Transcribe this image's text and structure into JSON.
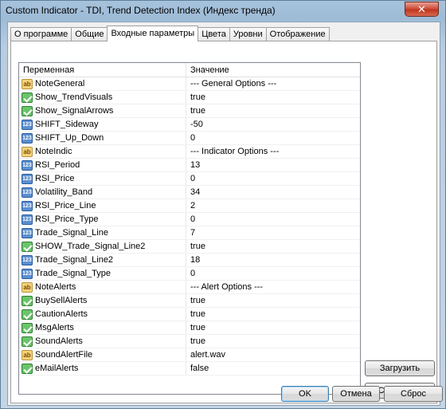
{
  "window": {
    "title": "Custom Indicator - TDI, Trend Detection Index (Индекс тренда)",
    "close_glyph": "✕"
  },
  "tabs": [
    {
      "label": "О программе"
    },
    {
      "label": "Общие"
    },
    {
      "label": "Входные параметры",
      "active": true
    },
    {
      "label": "Цвета"
    },
    {
      "label": "Уровни"
    },
    {
      "label": "Отображение"
    }
  ],
  "grid": {
    "headers": {
      "name": "Переменная",
      "value": "Значение"
    },
    "rows": [
      {
        "icon": "text-icon",
        "glyph": "ab",
        "name": "NoteGeneral",
        "value": "--- General Options ---"
      },
      {
        "icon": "bool-icon",
        "glyph": "",
        "name": "Show_TrendVisuals",
        "value": "true"
      },
      {
        "icon": "bool-icon",
        "glyph": "",
        "name": "Show_SignalArrows",
        "value": "true"
      },
      {
        "icon": "number-icon",
        "glyph": "123",
        "name": "SHIFT_Sideway",
        "value": "-50"
      },
      {
        "icon": "number-icon",
        "glyph": "123",
        "name": "SHIFT_Up_Down",
        "value": "0"
      },
      {
        "icon": "text-icon",
        "glyph": "ab",
        "name": "NoteIndic",
        "value": "--- Indicator Options ---"
      },
      {
        "icon": "number-icon",
        "glyph": "123",
        "name": "RSI_Period",
        "value": "13"
      },
      {
        "icon": "number-icon",
        "glyph": "123",
        "name": "RSI_Price",
        "value": "0"
      },
      {
        "icon": "number-icon",
        "glyph": "123",
        "name": "Volatility_Band",
        "value": "34"
      },
      {
        "icon": "number-icon",
        "glyph": "123",
        "name": "RSI_Price_Line",
        "value": "2"
      },
      {
        "icon": "number-icon",
        "glyph": "123",
        "name": "RSI_Price_Type",
        "value": "0"
      },
      {
        "icon": "number-icon",
        "glyph": "123",
        "name": "Trade_Signal_Line",
        "value": "7"
      },
      {
        "icon": "bool-icon",
        "glyph": "",
        "name": "SHOW_Trade_Signal_Line2",
        "value": "true"
      },
      {
        "icon": "number-icon",
        "glyph": "123",
        "name": "Trade_Signal_Line2",
        "value": "18"
      },
      {
        "icon": "number-icon",
        "glyph": "123",
        "name": "Trade_Signal_Type",
        "value": "0"
      },
      {
        "icon": "text-icon",
        "glyph": "ab",
        "name": "NoteAlerts",
        "value": "--- Alert Options ---"
      },
      {
        "icon": "bool-icon",
        "glyph": "",
        "name": "BuySellAlerts",
        "value": "true"
      },
      {
        "icon": "bool-icon",
        "glyph": "",
        "name": "CautionAlerts",
        "value": "true"
      },
      {
        "icon": "bool-icon",
        "glyph": "",
        "name": "MsgAlerts",
        "value": "true"
      },
      {
        "icon": "bool-icon",
        "glyph": "",
        "name": "SoundAlerts",
        "value": "true"
      },
      {
        "icon": "text-icon",
        "glyph": "ab",
        "name": "SoundAlertFile",
        "value": "alert.wav"
      },
      {
        "icon": "bool-icon",
        "glyph": "",
        "name": "eMailAlerts",
        "value": "false"
      }
    ]
  },
  "buttons": {
    "load": "Загрузить",
    "save": "Сохранить",
    "ok": "OK",
    "cancel": "Отмена",
    "reset": "Сброс"
  }
}
